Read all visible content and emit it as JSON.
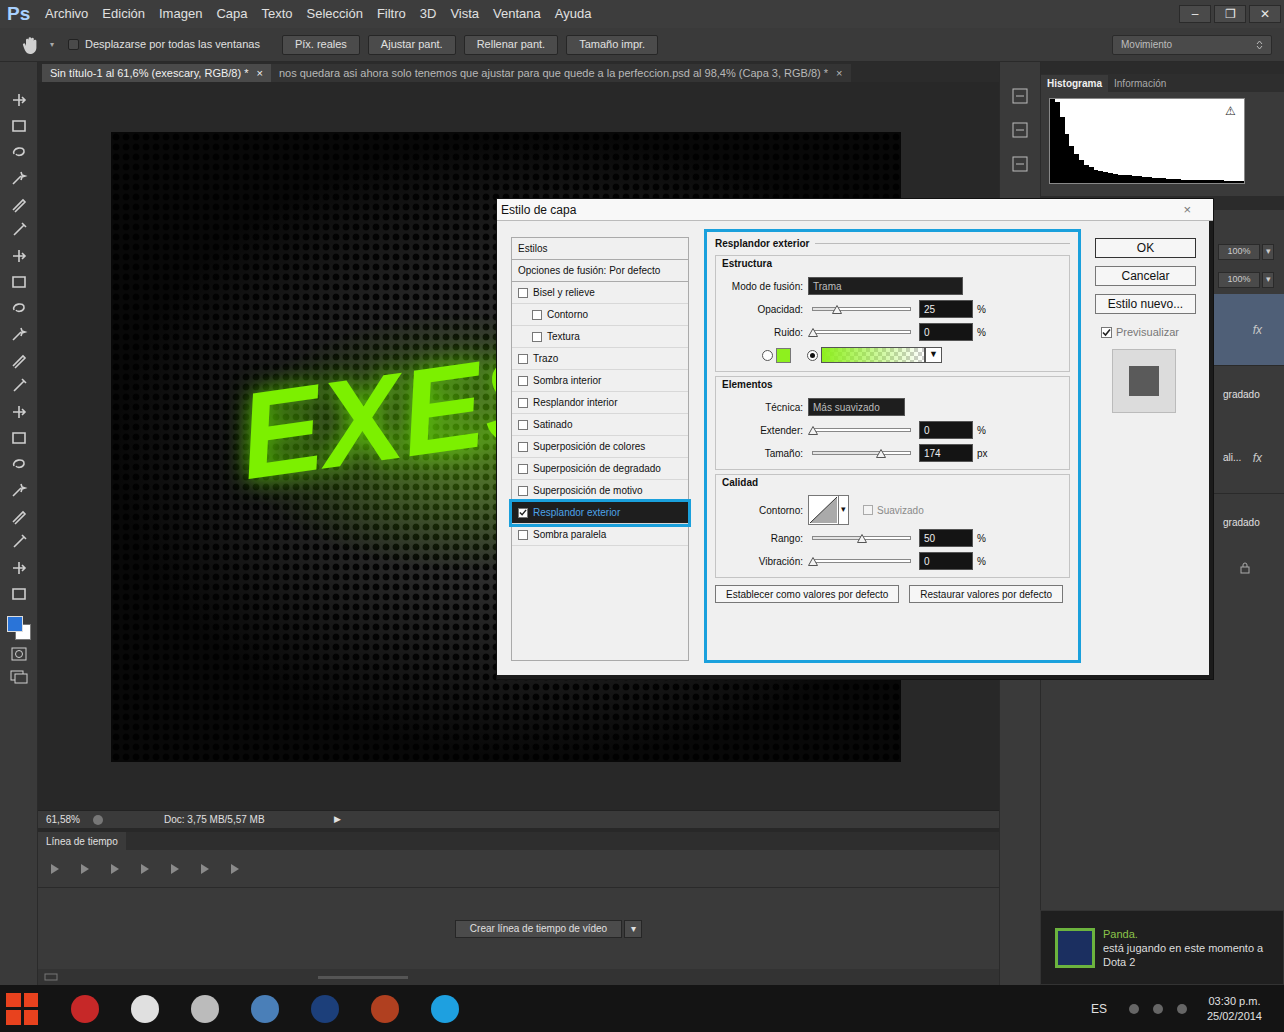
{
  "app": {
    "logo": "Ps"
  },
  "menu": [
    "Archivo",
    "Edición",
    "Imagen",
    "Capa",
    "Texto",
    "Selección",
    "Filtro",
    "3D",
    "Vista",
    "Ventana",
    "Ayuda"
  ],
  "window_controls": [
    "–",
    "❐",
    "✕"
  ],
  "options_bar": {
    "scroll_all": {
      "label": "Desplazarse por todas las ventanas",
      "checked": false
    },
    "buttons": [
      "Píx. reales",
      "Ajustar pant.",
      "Rellenar pant.",
      "Tamaño impr."
    ],
    "workspace": "Movimiento"
  },
  "tabs": [
    {
      "label": "Sin título-1 al 61,6% (exescary, RGB/8) *",
      "close": "×",
      "selected": true
    },
    {
      "label": "nos quedara asi ahora solo tenemos que ajustar para que quede a la perfeccion.psd al 98,4% (Capa 3, RGB/8) *",
      "close": "×",
      "selected": false
    }
  ],
  "canvas": {
    "text": "EXES",
    "color": "#7cf000"
  },
  "status_bar": {
    "zoom": "61,58%",
    "doc": "Doc: 3,75 MB/5,57 MB",
    "arrow": "▶"
  },
  "timeline": {
    "title": "Línea de tiempo",
    "button": "Crear línea de tiempo de vídeo",
    "dropdown": "▾"
  },
  "histogram_panel": {
    "tabs": [
      {
        "label": "Histograma",
        "selected": true
      },
      {
        "label": "Información",
        "selected": false
      }
    ],
    "warning": "⚠",
    "values": [
      100,
      96,
      78,
      58,
      44,
      34,
      27,
      22,
      19,
      16,
      14,
      13,
      12,
      11,
      10,
      9,
      9,
      8,
      8,
      7,
      7,
      6,
      6,
      6,
      5,
      5,
      5,
      4,
      4,
      4,
      4,
      3,
      3,
      3,
      3,
      3,
      2,
      2,
      2,
      2
    ]
  },
  "layers_panel": {
    "opacity": "100%",
    "fill": "100%",
    "arrow": "▾",
    "rows": [
      {
        "kind": "layer",
        "fx": "fx",
        "selected": true
      },
      {
        "kind": "effect",
        "label": "gradado",
        "selected": false
      },
      {
        "kind": "layer",
        "label": "ali...",
        "fx": "fx",
        "selected": false
      },
      {
        "kind": "effect",
        "label": "gradado",
        "selected": false
      }
    ]
  },
  "dialog": {
    "title": "Estilo de capa",
    "close": "×",
    "styles_header": "Estilos",
    "blend_options": "Opciones de fusión: Por defecto",
    "effects": [
      {
        "label": "Bisel y relieve",
        "kind": "effect",
        "checked": false,
        "selected": false
      },
      {
        "label": "Contorno",
        "kind": "sub",
        "checked": false,
        "selected": false
      },
      {
        "label": "Textura",
        "kind": "sub",
        "checked": false,
        "selected": false
      },
      {
        "label": "Trazo",
        "kind": "effect",
        "checked": false,
        "selected": false
      },
      {
        "label": "Sombra interior",
        "kind": "effect",
        "checked": false,
        "selected": false
      },
      {
        "label": "Resplandor interior",
        "kind": "effect",
        "checked": false,
        "selected": false
      },
      {
        "label": "Satinado",
        "kind": "effect",
        "checked": false,
        "selected": false
      },
      {
        "label": "Superposición de colores",
        "kind": "effect",
        "checked": false,
        "selected": false
      },
      {
        "label": "Superposición de degradado",
        "kind": "effect",
        "checked": false,
        "selected": false
      },
      {
        "label": "Superposición de motivo",
        "kind": "effect",
        "checked": false,
        "selected": false
      },
      {
        "label": "Resplandor exterior",
        "kind": "effect",
        "checked": true,
        "selected": true
      },
      {
        "label": "Sombra paralela",
        "kind": "effect",
        "checked": false,
        "selected": false
      }
    ],
    "panel": {
      "title": "Resplandor exterior",
      "sections": [
        {
          "title": "Estructura",
          "rows": [
            {
              "kind": "select",
              "label": "Modo de fusión:",
              "value": "Trama"
            },
            {
              "kind": "slider",
              "label": "Opacidad:",
              "level": 0.25,
              "value": "25",
              "unit": "%"
            },
            {
              "kind": "slider",
              "label": "Ruido:",
              "level": 0,
              "value": "0",
              "unit": "%"
            },
            {
              "kind": "fill",
              "color": "#8ef01e",
              "arrow": "▼",
              "options": [
                {
                  "kind": "color",
                  "selected": false
                },
                {
                  "kind": "gradient",
                  "selected": true
                }
              ]
            }
          ]
        },
        {
          "title": "Elementos",
          "rows": [
            {
              "kind": "select",
              "label": "Técnica:",
              "value": "Más suavizado"
            },
            {
              "kind": "slider",
              "label": "Extender:",
              "level": 0,
              "value": "0",
              "unit": "%"
            },
            {
              "kind": "slider",
              "label": "Tamaño:",
              "level": 0.7,
              "value": "174",
              "unit": "px"
            }
          ]
        },
        {
          "title": "Calidad",
          "rows": [
            {
              "kind": "contour",
              "label": "Contorno:",
              "arrow": "▾",
              "checkbox": {
                "label": "Suavizado",
                "checked": false,
                "disabled": true
              }
            },
            {
              "kind": "slider",
              "label": "Rango:",
              "level": 0.5,
              "value": "50",
              "unit": "%"
            },
            {
              "kind": "slider",
              "label": "Vibración:",
              "level": 0,
              "value": "0",
              "unit": "%"
            }
          ]
        }
      ],
      "defaults": [
        "Establecer como valores por defecto",
        "Restaurar valores por defecto"
      ]
    },
    "buttons": [
      "OK",
      "Cancelar",
      "Estilo nuevo..."
    ],
    "preview": {
      "label": "Previsualizar",
      "checked": true
    }
  },
  "notification": {
    "title": "Panda.",
    "line": "está jugando en este momento a",
    "game": "Dota 2"
  },
  "taskbar": {
    "lang": "ES",
    "time": "03:30 p.m.",
    "date": "25/02/2014"
  }
}
